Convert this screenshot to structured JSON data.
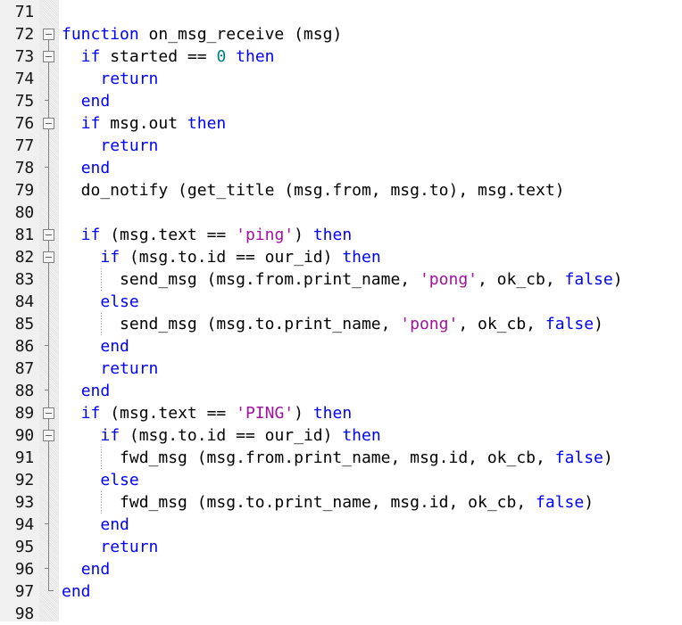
{
  "editor": {
    "name": "code-editor",
    "language": "Lua",
    "colors": {
      "background": "#ffffff",
      "gutter_background": "#f0f0f0",
      "line_number": "#141414",
      "keyword": "#0000ff",
      "string": "#a0119e",
      "number": "#008080",
      "identifier": "#000000",
      "fold_marker": "#808080",
      "indent_guide": "#9a9a9a"
    },
    "first_visible_line": 71,
    "last_visible_line": 98,
    "line_height_px": 25,
    "font_size_px": 18
  },
  "line_numbers": [
    "71",
    "72",
    "73",
    "74",
    "75",
    "76",
    "77",
    "78",
    "79",
    "80",
    "81",
    "82",
    "83",
    "84",
    "85",
    "86",
    "87",
    "88",
    "89",
    "90",
    "91",
    "92",
    "93",
    "94",
    "95",
    "96",
    "97",
    "98"
  ],
  "lines": [
    {
      "number": "71",
      "text": "",
      "indent_guides": [],
      "fold": "none",
      "tokens": []
    },
    {
      "number": "72",
      "text": "function on_msg_receive (msg)",
      "indent_guides": [],
      "fold": "open-start",
      "tokens": [
        {
          "t": "function",
          "c": "kw"
        },
        {
          "t": " on_msg_receive (msg)",
          "c": "id"
        }
      ]
    },
    {
      "number": "73",
      "text": "  if started == 0 then",
      "indent_guides": [],
      "fold": "open",
      "tokens": [
        {
          "t": "  ",
          "c": "id"
        },
        {
          "t": "if",
          "c": "kw"
        },
        {
          "t": " started ",
          "c": "id"
        },
        {
          "t": "==",
          "c": "op"
        },
        {
          "t": " ",
          "c": "id"
        },
        {
          "t": "0",
          "c": "num"
        },
        {
          "t": " ",
          "c": "id"
        },
        {
          "t": "then",
          "c": "kw"
        }
      ]
    },
    {
      "number": "74",
      "text": "    return",
      "indent_guides": [],
      "fold": "body",
      "tokens": [
        {
          "t": "    ",
          "c": "id"
        },
        {
          "t": "return",
          "c": "kw"
        }
      ]
    },
    {
      "number": "75",
      "text": "  end",
      "indent_guides": [],
      "fold": "tick",
      "tokens": [
        {
          "t": "  ",
          "c": "id"
        },
        {
          "t": "end",
          "c": "kw"
        }
      ]
    },
    {
      "number": "76",
      "text": "  if msg.out then",
      "indent_guides": [],
      "fold": "open",
      "tokens": [
        {
          "t": "  ",
          "c": "id"
        },
        {
          "t": "if",
          "c": "kw"
        },
        {
          "t": " msg.out ",
          "c": "id"
        },
        {
          "t": "then",
          "c": "kw"
        }
      ]
    },
    {
      "number": "77",
      "text": "    return",
      "indent_guides": [],
      "fold": "body",
      "tokens": [
        {
          "t": "    ",
          "c": "id"
        },
        {
          "t": "return",
          "c": "kw"
        }
      ]
    },
    {
      "number": "78",
      "text": "  end",
      "indent_guides": [],
      "fold": "tick",
      "tokens": [
        {
          "t": "  ",
          "c": "id"
        },
        {
          "t": "end",
          "c": "kw"
        }
      ]
    },
    {
      "number": "79",
      "text": "  do_notify (get_title (msg.from, msg.to), msg.text)",
      "indent_guides": [],
      "fold": "body",
      "tokens": [
        {
          "t": "  do_notify (get_title (msg.from, msg.to), msg.text)",
          "c": "id"
        }
      ]
    },
    {
      "number": "80",
      "text": "",
      "indent_guides": [],
      "fold": "body",
      "tokens": []
    },
    {
      "number": "81",
      "text": "  if (msg.text == 'ping') then",
      "indent_guides": [],
      "fold": "open",
      "tokens": [
        {
          "t": "  ",
          "c": "id"
        },
        {
          "t": "if",
          "c": "kw"
        },
        {
          "t": " (msg.text ",
          "c": "id"
        },
        {
          "t": "==",
          "c": "op"
        },
        {
          "t": " ",
          "c": "id"
        },
        {
          "t": "'ping'",
          "c": "str"
        },
        {
          "t": ") ",
          "c": "id"
        },
        {
          "t": "then",
          "c": "kw"
        }
      ]
    },
    {
      "number": "82",
      "text": "    if (msg.to.id == our_id) then",
      "indent_guides": [],
      "fold": "open",
      "tokens": [
        {
          "t": "    ",
          "c": "id"
        },
        {
          "t": "if",
          "c": "kw"
        },
        {
          "t": " (msg.to.id ",
          "c": "id"
        },
        {
          "t": "==",
          "c": "op"
        },
        {
          "t": " our_id) ",
          "c": "id"
        },
        {
          "t": "then",
          "c": "kw"
        }
      ]
    },
    {
      "number": "83",
      "text": "      send_msg (msg.from.print_name, 'pong', ok_cb, false)",
      "indent_guides": [
        4
      ],
      "fold": "body",
      "tokens": [
        {
          "t": "      send_msg (msg.from.print_name, ",
          "c": "id"
        },
        {
          "t": "'pong'",
          "c": "str"
        },
        {
          "t": ", ok_cb, ",
          "c": "id"
        },
        {
          "t": "false",
          "c": "kw"
        },
        {
          "t": ")",
          "c": "id"
        }
      ]
    },
    {
      "number": "84",
      "text": "    else",
      "indent_guides": [],
      "fold": "body",
      "tokens": [
        {
          "t": "    ",
          "c": "id"
        },
        {
          "t": "else",
          "c": "kw"
        }
      ]
    },
    {
      "number": "85",
      "text": "      send_msg (msg.to.print_name, 'pong', ok_cb, false)",
      "indent_guides": [
        4
      ],
      "fold": "body",
      "tokens": [
        {
          "t": "      send_msg (msg.to.print_name, ",
          "c": "id"
        },
        {
          "t": "'pong'",
          "c": "str"
        },
        {
          "t": ", ok_cb, ",
          "c": "id"
        },
        {
          "t": "false",
          "c": "kw"
        },
        {
          "t": ")",
          "c": "id"
        }
      ]
    },
    {
      "number": "86",
      "text": "    end",
      "indent_guides": [],
      "fold": "tick",
      "tokens": [
        {
          "t": "    ",
          "c": "id"
        },
        {
          "t": "end",
          "c": "kw"
        }
      ]
    },
    {
      "number": "87",
      "text": "    return",
      "indent_guides": [],
      "fold": "body",
      "tokens": [
        {
          "t": "    ",
          "c": "id"
        },
        {
          "t": "return",
          "c": "kw"
        }
      ]
    },
    {
      "number": "88",
      "text": "  end",
      "indent_guides": [],
      "fold": "tick",
      "tokens": [
        {
          "t": "  ",
          "c": "id"
        },
        {
          "t": "end",
          "c": "kw"
        }
      ]
    },
    {
      "number": "89",
      "text": "  if (msg.text == 'PING') then",
      "indent_guides": [],
      "fold": "open",
      "tokens": [
        {
          "t": "  ",
          "c": "id"
        },
        {
          "t": "if",
          "c": "kw"
        },
        {
          "t": " (msg.text ",
          "c": "id"
        },
        {
          "t": "==",
          "c": "op"
        },
        {
          "t": " ",
          "c": "id"
        },
        {
          "t": "'PING'",
          "c": "str"
        },
        {
          "t": ") ",
          "c": "id"
        },
        {
          "t": "then",
          "c": "kw"
        }
      ]
    },
    {
      "number": "90",
      "text": "    if (msg.to.id == our_id) then",
      "indent_guides": [],
      "fold": "open",
      "tokens": [
        {
          "t": "    ",
          "c": "id"
        },
        {
          "t": "if",
          "c": "kw"
        },
        {
          "t": " (msg.to.id ",
          "c": "id"
        },
        {
          "t": "==",
          "c": "op"
        },
        {
          "t": " our_id) ",
          "c": "id"
        },
        {
          "t": "then",
          "c": "kw"
        }
      ]
    },
    {
      "number": "91",
      "text": "      fwd_msg (msg.from.print_name, msg.id, ok_cb, false)",
      "indent_guides": [
        4
      ],
      "fold": "body",
      "tokens": [
        {
          "t": "      fwd_msg (msg.from.print_name, msg.id, ok_cb, ",
          "c": "id"
        },
        {
          "t": "false",
          "c": "kw"
        },
        {
          "t": ")",
          "c": "id"
        }
      ]
    },
    {
      "number": "92",
      "text": "    else",
      "indent_guides": [],
      "fold": "body",
      "tokens": [
        {
          "t": "    ",
          "c": "id"
        },
        {
          "t": "else",
          "c": "kw"
        }
      ]
    },
    {
      "number": "93",
      "text": "      fwd_msg (msg.to.print_name, msg.id, ok_cb, false)",
      "indent_guides": [
        4
      ],
      "fold": "body",
      "tokens": [
        {
          "t": "      fwd_msg (msg.to.print_name, msg.id, ok_cb, ",
          "c": "id"
        },
        {
          "t": "false",
          "c": "kw"
        },
        {
          "t": ")",
          "c": "id"
        }
      ]
    },
    {
      "number": "94",
      "text": "    end",
      "indent_guides": [],
      "fold": "tick",
      "tokens": [
        {
          "t": "    ",
          "c": "id"
        },
        {
          "t": "end",
          "c": "kw"
        }
      ]
    },
    {
      "number": "95",
      "text": "    return",
      "indent_guides": [],
      "fold": "body",
      "tokens": [
        {
          "t": "    ",
          "c": "id"
        },
        {
          "t": "return",
          "c": "kw"
        }
      ]
    },
    {
      "number": "96",
      "text": "  end",
      "indent_guides": [],
      "fold": "tick",
      "tokens": [
        {
          "t": "  ",
          "c": "id"
        },
        {
          "t": "end",
          "c": "kw"
        }
      ]
    },
    {
      "number": "97",
      "text": "end",
      "indent_guides": [],
      "fold": "corner",
      "tokens": [
        {
          "t": "end",
          "c": "kw"
        }
      ]
    },
    {
      "number": "98",
      "text": "",
      "indent_guides": [],
      "fold": "none",
      "tokens": []
    }
  ]
}
